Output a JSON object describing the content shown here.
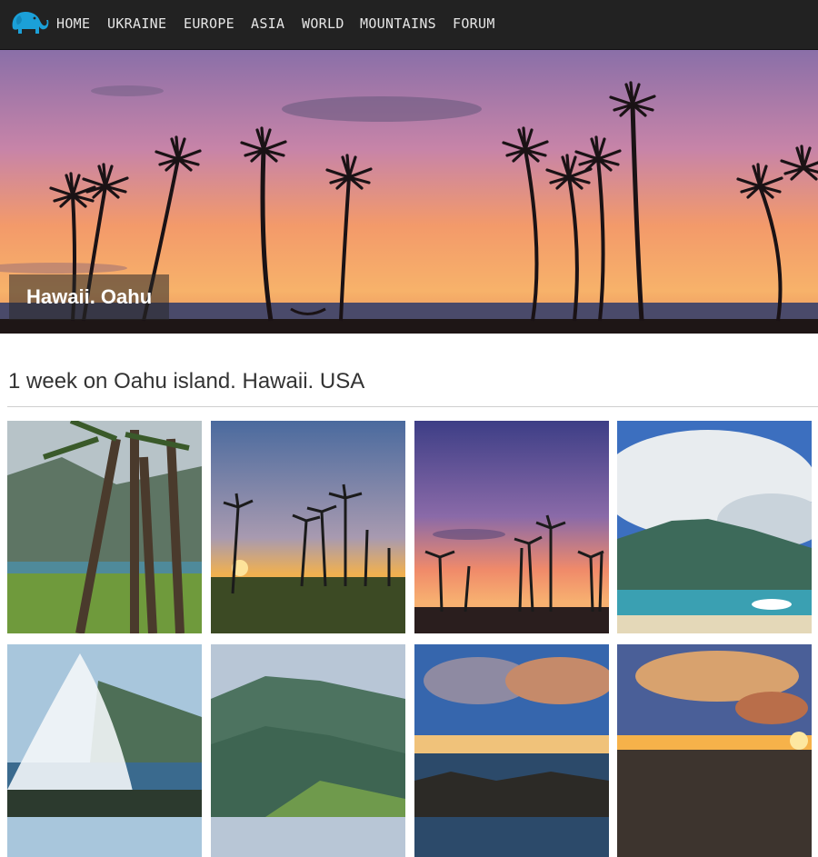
{
  "nav": {
    "logo_icon": "elephant-icon",
    "items": [
      {
        "label": "HOME"
      },
      {
        "label": "UKRAINE"
      },
      {
        "label": "EUROPE"
      },
      {
        "label": "ASIA"
      },
      {
        "label": "WORLD"
      },
      {
        "label": "MOUNTAINS"
      },
      {
        "label": "FORUM"
      }
    ]
  },
  "hero": {
    "caption": "Hawaii. Oahu"
  },
  "article": {
    "heading": "1 week on Oahu island. Hawaii. USA"
  },
  "colors": {
    "navbar_bg": "#222222",
    "nav_text": "#e6e6e6",
    "logo_blue": "#1ba0d8",
    "heading_text": "#333333"
  }
}
